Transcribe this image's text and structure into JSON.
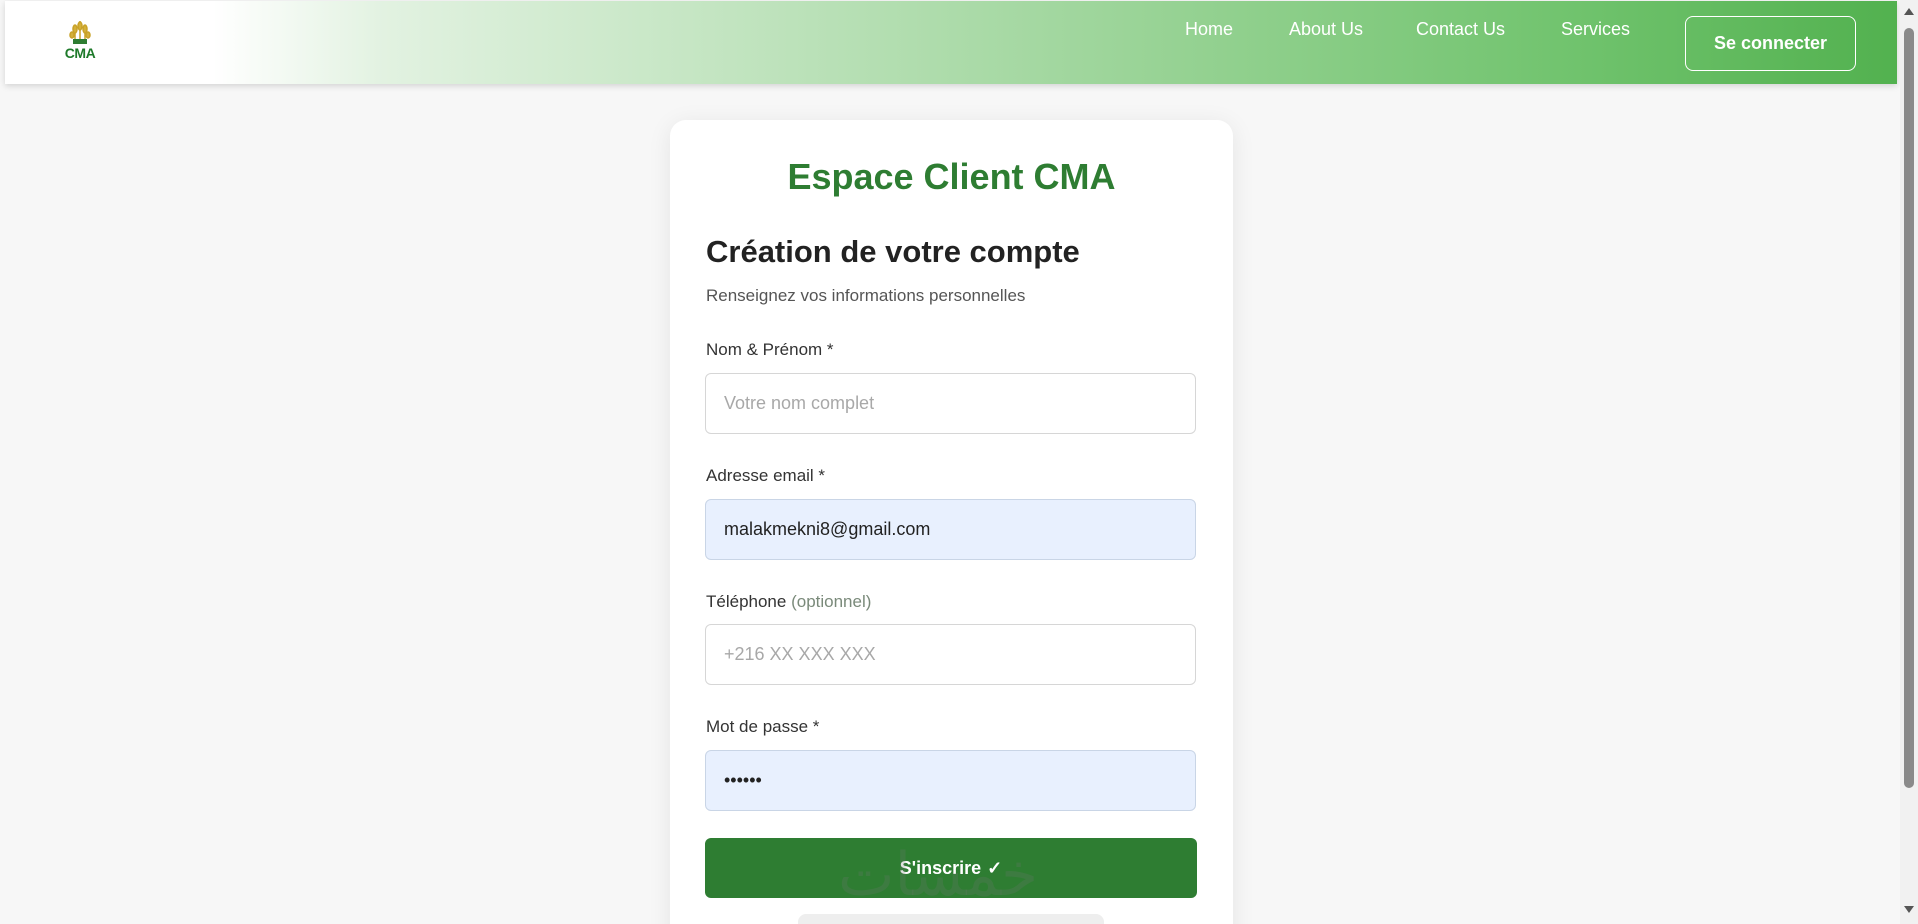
{
  "header": {
    "logo_text": "CMA",
    "nav": [
      {
        "label": "Home"
      },
      {
        "label": "About Us"
      },
      {
        "label": "Contact Us"
      },
      {
        "label": "Services"
      }
    ],
    "login_label": "Se connecter"
  },
  "card": {
    "brand_title": "Espace Client CMA",
    "form_title": "Création de votre compte",
    "form_subtitle": "Renseignez vos informations personnelles",
    "fields": {
      "name": {
        "label": "Nom & Prénom *",
        "placeholder": "Votre nom complet",
        "value": ""
      },
      "email": {
        "label": "Adresse email *",
        "placeholder": "",
        "value": "malakmekni8@gmail.com"
      },
      "phone": {
        "label": "Téléphone",
        "optional": "(optionnel)",
        "placeholder": "+216 XX XXX XXX",
        "value": ""
      },
      "password": {
        "label": "Mot de passe *",
        "placeholder": "",
        "value": "••••••"
      }
    },
    "submit_label": "S'inscrire",
    "submit_icon": "✓"
  },
  "watermark_text": "خمسات",
  "colors": {
    "primary_green": "#2e7d32",
    "header_gradient_end": "#52b14f",
    "autofill_bg": "#e8f0fe"
  },
  "icons": {
    "logo": "wheat-logo-icon",
    "submit": "check-icon"
  }
}
